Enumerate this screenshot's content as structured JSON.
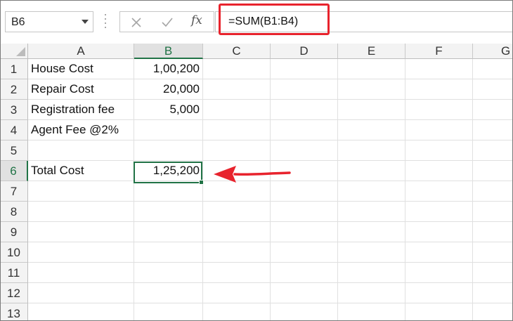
{
  "name_box": {
    "value": "B6"
  },
  "formula_bar": {
    "cancel_icon": "cancel-icon",
    "enter_icon": "enter-icon",
    "fx_label": "fx",
    "formula": "=SUM(B1:B4)"
  },
  "columns": [
    "A",
    "B",
    "C",
    "D",
    "E",
    "F",
    "G"
  ],
  "rows": [
    "1",
    "2",
    "3",
    "4",
    "5",
    "6",
    "7",
    "8",
    "9",
    "10",
    "11",
    "12",
    "13"
  ],
  "cells": {
    "A1": "House Cost",
    "B1": "1,00,200",
    "A2": "Repair Cost",
    "B2": "20,000",
    "A3": "Registration fee",
    "B3": "5,000",
    "A4": "Agent Fee @2%",
    "A6": "Total Cost",
    "B6": "1,25,200"
  },
  "selection": {
    "cell": "B6",
    "column": "B",
    "row": "6"
  },
  "colors": {
    "accent": "#217346",
    "highlight": "#e8232d"
  }
}
